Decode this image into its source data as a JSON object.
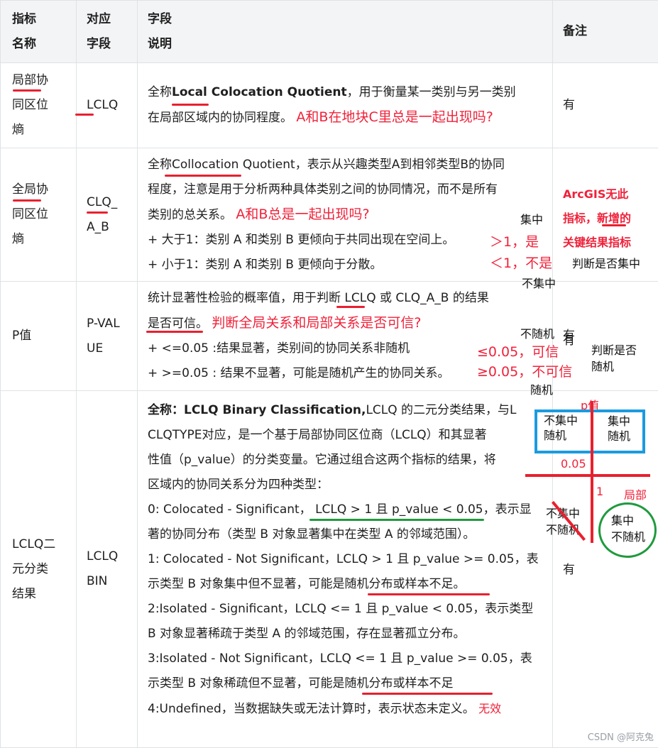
{
  "table": {
    "headers": [
      {
        "line1": "指标",
        "line2": "名称"
      },
      {
        "line1": "对应",
        "line2": "字段"
      },
      {
        "line1": "字段",
        "line2": "说明"
      },
      {
        "line1": "备注",
        "line2": ""
      }
    ],
    "rows": [
      {
        "name_lines": [
          "局部协",
          "同区位",
          "熵"
        ],
        "field_lines": [
          "LCLQ"
        ],
        "desc_lines": [
          [
            "全称",
            "Local Colocation Quotient",
            "，用于衡量某一类别与另一类别"
          ],
          [
            "在局部区域内的协同程度。"
          ]
        ],
        "desc_red": "A和B在地块C里总是一起出现吗?",
        "note": "有"
      },
      {
        "name_lines": [
          "全局协",
          "同区位",
          "熵"
        ],
        "field_lines": [
          "CLQ_",
          "A_B"
        ],
        "desc_lines": [
          "全称Collocation Quotient，表示从兴趣类型A到相邻类型B的协同",
          "程度，注意是用于分析两种具体类别之间的协同情况，而不是所有",
          "类别的总关系。",
          "+ 大于1：类别 A 和类别 B 更倾向于共同出现在空间上。",
          "+ 小于1：类别 A 和类别 B 更倾向于分散。"
        ],
        "desc_red": "A和B总是一起出现吗?",
        "note_lines": [
          "ArcGIS无此",
          "指标，新增的",
          "关键结果指标"
        ]
      },
      {
        "name_lines": [
          "P值"
        ],
        "field_lines": [
          "P-VAL",
          "UE"
        ],
        "desc_lines": [
          "统计显著性检验的概率值，用于判断 LCLQ 或 CLQ_A_B 的结果",
          "是否可信。",
          "+ <=0.05 :结果显著，类别间的协同关系非随机",
          "+ >=0.05 : 结果不显著，可能是随机产生的协同关系。"
        ],
        "desc_red": "判断全局关系和局部关系是否可信?",
        "note": "有"
      },
      {
        "name_lines": [
          "LCLQ二",
          "元分类",
          "结果"
        ],
        "field_lines": [
          "LCLQ",
          "BIN"
        ],
        "desc_lead_bold": "全称：LCLQ Binary Classification,",
        "desc_lines": [
          "LCLQ 的二元分类结果，与L",
          "CLQTYPE对应，是一个基于局部协同区位商（LCLQ）和其显著",
          "性值（p_value）的分类变量。它通过组合这两个指标的结果，将",
          "区域内的协同关系分为四种类型：",
          "0: Colocated - Significant， LCLQ > 1 且 p_value < 0.05，表示显",
          "著的协同分布（类型 B 对象显著集中在类型 A 的邻域范围）。",
          "1: Colocated - Not Significant，LCLQ > 1 且 p_value >= 0.05，表",
          "示类型 B 对象集中但不显著，可能是随机分布或样本不足。",
          "2:Isolated - Significant，LCLQ <= 1 且 p_value < 0.05，表示类型",
          "B 对象显著稀疏于类型 A 的邻域范围，存在显著孤立分布。",
          "3:Isolated - Not Significant，LCLQ <= 1 且 p_value >= 0.05，表",
          "示类型 B 对象稀疏但不显著，可能是随机分布或样本不足",
          "4:Undefined，当数据缺失或无法计算时，表示状态未定义。"
        ],
        "desc_red_tail": "无效",
        "note": "有"
      }
    ]
  },
  "annotations": {
    "jizhong_top": "集中",
    "gt1": "＞1，是",
    "lt1": "＜1，不是",
    "bujizhong": "不集中",
    "judge_jizhong": "判断是否集中",
    "bu_suiji": "不随机",
    "le005": "≤0.05，可信",
    "ge005": "≥0.05，不可信",
    "judge_suiji_1": "判断是否",
    "judge_suiji_2": "随机",
    "suiji": "随机",
    "you": "有",
    "pval_label": "p值",
    "q_tl_1": "不集中",
    "q_tl_2": "随机",
    "q_tr_1": "集中",
    "q_tr_2": "随机",
    "axis_005": "0.05",
    "axis_1": "1",
    "axis_local": "局部",
    "q_bl_1": "不集中",
    "q_bl_2": "不随机",
    "q_br_1": "集中",
    "q_br_2": "不随机"
  },
  "watermark": "CSDN @阿克兔",
  "colors": {
    "red_ink": "#f0223a",
    "green_ink": "#1f9a3e",
    "blue_box": "#1a9be0",
    "header_bg": "#f3f4f6"
  }
}
